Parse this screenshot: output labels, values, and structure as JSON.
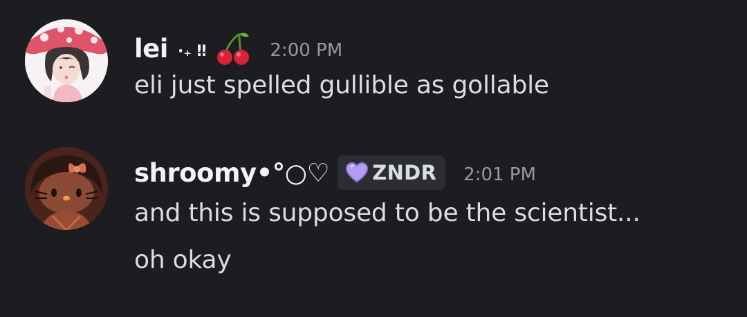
{
  "messages": [
    {
      "username": "lei",
      "username_decoration": "·₊ ‼",
      "decoration_icon": "cherry-emoji",
      "timestamp": "2:00 PM",
      "content_lines": [
        "eli just spelled gullible as gollable"
      ],
      "avatar_icon": "mushroom-hat-anime-avatar"
    },
    {
      "username": "shroomy•°○♡",
      "tag": {
        "icon": "purple-heart-icon",
        "label": "ZNDR",
        "color": "#b49cf0"
      },
      "timestamp": "2:01 PM",
      "content_lines": [
        "and this is supposed to be the scientist...",
        "oh okay"
      ],
      "avatar_icon": "hello-kitty-bow-avatar"
    }
  ],
  "colors": {
    "background": "#1c1c21",
    "username": "#f2f3f5",
    "message_text": "#dbdee1",
    "timestamp": "#949ba4",
    "tag_background": "#2b2d33"
  }
}
